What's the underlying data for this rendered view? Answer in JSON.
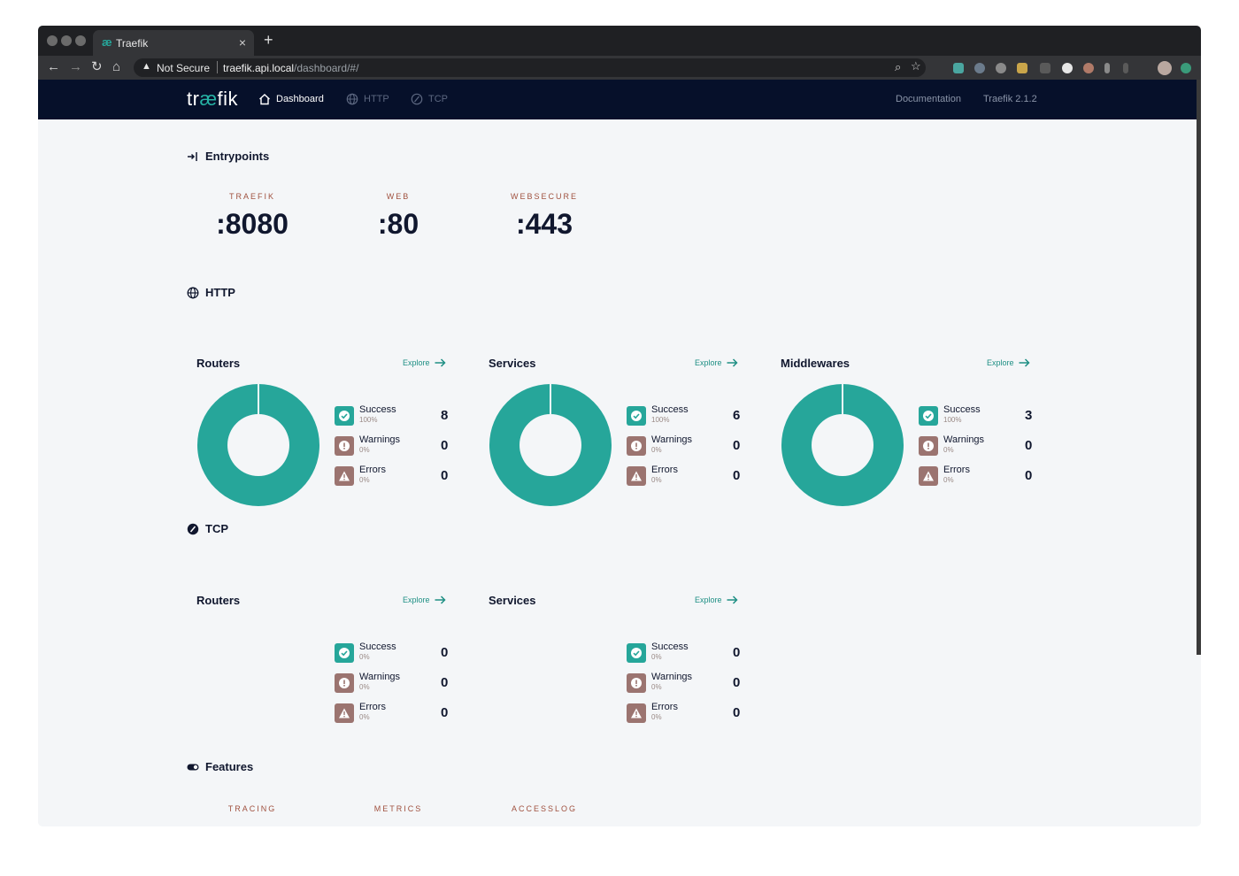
{
  "browser": {
    "tab_title": "Traefik",
    "url_security": "Not Secure",
    "url_host": "traefik.api.local",
    "url_path": "/dashboard/#/"
  },
  "app": {
    "logo_prefix": "tr",
    "logo_ae": "æ",
    "logo_suffix": "fik",
    "nav": {
      "dashboard": "Dashboard",
      "http": "HTTP",
      "tcp": "TCP"
    },
    "documentation": "Documentation",
    "version": "Traefik 2.1.2"
  },
  "entrypoints": {
    "title": "Entrypoints",
    "items": [
      {
        "label": "TRAEFIK",
        "value": ":8080"
      },
      {
        "label": "WEB",
        "value": ":80"
      },
      {
        "label": "WEBSECURE",
        "value": ":443"
      }
    ]
  },
  "labels": {
    "explore": "Explore",
    "success": "Success",
    "warnings": "Warnings",
    "errors": "Errors"
  },
  "colors": {
    "success": "#26a69a",
    "warnings": "#9b7470",
    "errors": "#9b7470",
    "nav_bg": "#06102a"
  },
  "http": {
    "title": "HTTP",
    "cards": [
      {
        "title": "Routers",
        "success": 8,
        "success_pct": "100%",
        "warnings": 0,
        "warnings_pct": "0%",
        "errors": 0,
        "errors_pct": "0%"
      },
      {
        "title": "Services",
        "success": 6,
        "success_pct": "100%",
        "warnings": 0,
        "warnings_pct": "0%",
        "errors": 0,
        "errors_pct": "0%"
      },
      {
        "title": "Middlewares",
        "success": 3,
        "success_pct": "100%",
        "warnings": 0,
        "warnings_pct": "0%",
        "errors": 0,
        "errors_pct": "0%"
      }
    ]
  },
  "tcp": {
    "title": "TCP",
    "cards": [
      {
        "title": "Routers",
        "success": 0,
        "success_pct": "0%",
        "warnings": 0,
        "warnings_pct": "0%",
        "errors": 0,
        "errors_pct": "0%"
      },
      {
        "title": "Services",
        "success": 0,
        "success_pct": "0%",
        "warnings": 0,
        "warnings_pct": "0%",
        "errors": 0,
        "errors_pct": "0%"
      }
    ]
  },
  "features": {
    "title": "Features",
    "items": [
      "TRACING",
      "METRICS",
      "ACCESSLOG"
    ]
  },
  "chart_data": [
    {
      "type": "pie",
      "id": "http-routers",
      "categories": [
        "Success",
        "Warnings",
        "Errors"
      ],
      "values": [
        8,
        0,
        0
      ]
    },
    {
      "type": "pie",
      "id": "http-services",
      "categories": [
        "Success",
        "Warnings",
        "Errors"
      ],
      "values": [
        6,
        0,
        0
      ]
    },
    {
      "type": "pie",
      "id": "http-middlewares",
      "categories": [
        "Success",
        "Warnings",
        "Errors"
      ],
      "values": [
        3,
        0,
        0
      ]
    }
  ]
}
